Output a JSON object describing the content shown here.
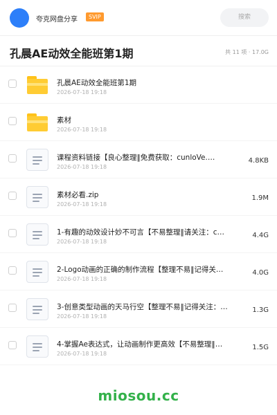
{
  "header": {
    "username": "夸克网盘分享",
    "badge": "SVIP",
    "search_placeholder": "搜索"
  },
  "share": {
    "title": "孔晨AE动效全能班第1期",
    "count": "共 11 项 · 17.0G"
  },
  "files": [
    {
      "type": "folder",
      "name": "孔晨AE动效全能班第1期",
      "date": "2026-07-18 19:18",
      "size": ""
    },
    {
      "type": "folder",
      "name": "素材",
      "date": "2026-07-18 19:18",
      "size": ""
    },
    {
      "type": "file",
      "name": "课程资料链接【良心整理‖免费获取：cunloVe.…",
      "date": "2026-07-18 19:18",
      "size": "4.8KB"
    },
    {
      "type": "file",
      "name": "素材必看.zip",
      "date": "2026-07-18 19:18",
      "size": "1.9M"
    },
    {
      "type": "file",
      "name": "1-有趣的动效设计妙不可言【不易整理‖请关注：cu…",
      "date": "2026-07-18 19:18",
      "size": "4.4G"
    },
    {
      "type": "file",
      "name": "2-Logo动画的正确的制作流程【整理不易‖记得关…",
      "date": "2026-07-18 19:18",
      "size": "4.0G"
    },
    {
      "type": "file",
      "name": "3-创意类型动画的天马行空【整理不易‖记得关注：c…",
      "date": "2026-07-18 19:18",
      "size": "1.3G"
    },
    {
      "type": "file",
      "name": "4-掌握Ae表达式，让动画制作更高效【不易整理‖请…",
      "date": "2026-07-18 19:18",
      "size": "1.5G"
    }
  ],
  "watermark": "miosou.cc",
  "colors": {
    "accent": "#2d7ff9",
    "badge": "#ff9a2e",
    "folder": "#ffcc33",
    "watermark": "#33b14a"
  }
}
